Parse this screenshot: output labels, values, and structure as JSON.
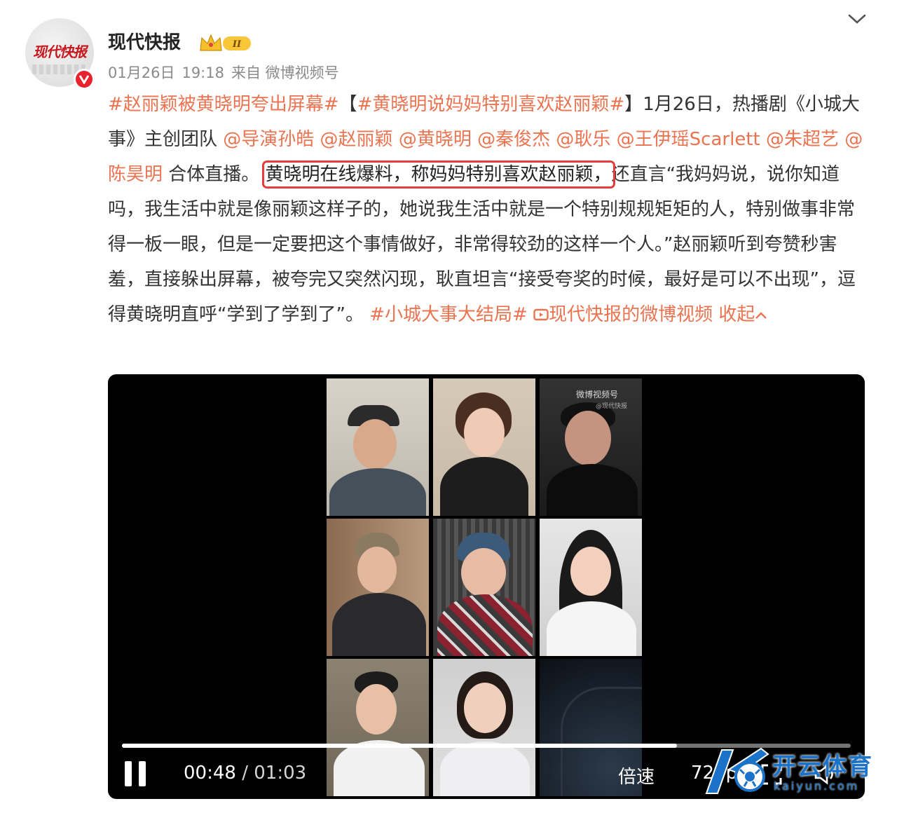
{
  "header": {
    "avatar_text": "现代快报",
    "account_name": "现代快报",
    "badge_text": "II",
    "date": "01月26日",
    "time": "19:18",
    "source": "来自 微博视频号"
  },
  "post": {
    "tag1": "#赵丽颖被黄晓明夸出屏幕#",
    "bracket_open": "【",
    "tag2": "#黄晓明说妈妈特别喜欢赵丽颖#",
    "bracket_close": "】",
    "text1": "1月26日，热播剧《小城大事》主创团队 ",
    "mentions": [
      "@导演孙皓",
      "@赵丽颖",
      "@黄晓明",
      "@秦俊杰",
      "@耿乐",
      "@王伊瑶Scarlett",
      "@朱超艺",
      "@陈昊明"
    ],
    "text2": " 合体直播。",
    "highlight": "黄晓明在线爆料，称妈妈特别喜欢赵丽颖，",
    "text3": "还直言“我妈妈说，说你知道吗，我生活中就是像丽颖这样子的，她说我生活中就是一个特别规规矩矩的人，特别做事非常得一板一眼，但是一定要把这个事情做好，非常得较劲的这样一个人。”赵丽颖听到夸赞秒害羞，直接躲出屏幕，被夸完又突然闪现，耿直坦言“接受夸奖的时候，最好是可以不出现”，逗得黄晓明直呼“学到了学到了”。",
    "tag3": "#小城大事大结局#",
    "video_link": "现代快报的微博视频",
    "collapse": "收起"
  },
  "video": {
    "watermark": "微博视频号",
    "watermark_sub": "@现代快报",
    "current_time": "00:48",
    "separator": " / ",
    "duration": "01:03",
    "progress": 0.762,
    "speed_label": "倍速",
    "quality_label": "720p"
  },
  "overlay": {
    "brand_cn": "开云体育",
    "brand_en": "kaiyun.com"
  },
  "colors": {
    "link": "#eb7350",
    "highlight_border": "#e33d3d",
    "verified": "#e8232e"
  }
}
